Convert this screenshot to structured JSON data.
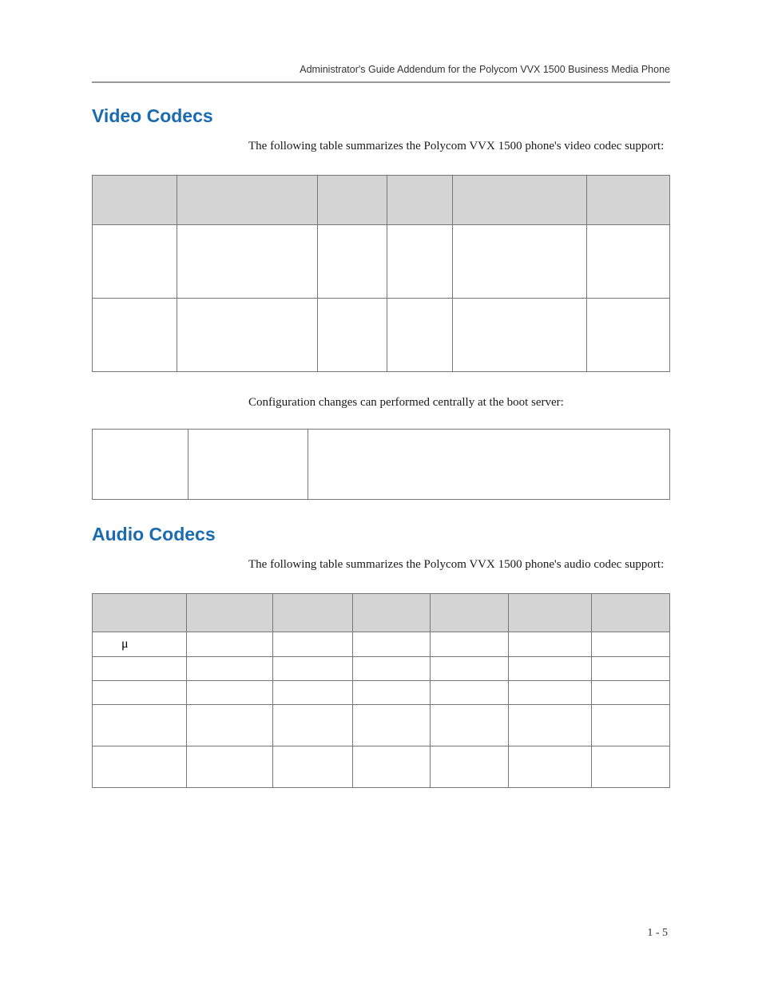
{
  "header": {
    "running_head": "Administrator's Guide Addendum for the Polycom VVX 1500 Business Media Phone"
  },
  "sections": {
    "video_codecs": {
      "heading": "Video Codecs",
      "intro": "The following table summarizes the Polycom VVX 1500 phone's video codec support:"
    },
    "config_line": "Configuration changes can performed centrally at the boot server:",
    "audio_codecs": {
      "heading": "Audio Codecs",
      "intro": "The following table summarizes the Polycom VVX 1500 phone's audio codec support:"
    }
  },
  "audio_symbols": {
    "mu": "μ"
  },
  "footer": {
    "page_number": "1 - 5"
  }
}
